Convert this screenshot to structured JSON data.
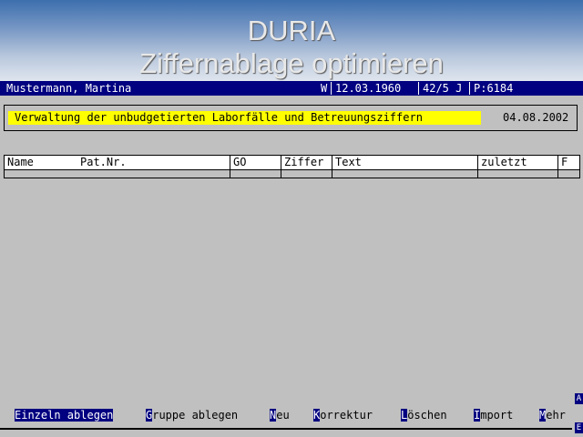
{
  "app": {
    "title": "DURIA",
    "subtitle": "Ziffernablage optimieren"
  },
  "patient": {
    "name": "Mustermann, Martina",
    "sex": "W",
    "birthdate": "12.03.1960",
    "age": "42/5 J",
    "pat_id": "P:6184"
  },
  "info": {
    "title": "Verwaltung der unbudgetierten Laborfälle und Betreuungsziffern",
    "date": "04.08.2002"
  },
  "table": {
    "columns": [
      "Name",
      "Pat.Nr.",
      "GO",
      "Ziffer",
      "Text",
      "zuletzt",
      "F"
    ]
  },
  "menu": {
    "einzeln": {
      "hk": "Einzeln ablegen",
      "rest": ""
    },
    "gruppe": {
      "hk": "G",
      "rest": "ruppe ablegen"
    },
    "neu": {
      "hk": "N",
      "rest": "eu"
    },
    "korrektur": {
      "hk": "K",
      "rest": "orrektur"
    },
    "loeschen": {
      "hk": "L",
      "rest": "öschen"
    },
    "import": {
      "hk": "I",
      "rest": "mport"
    },
    "mehr": {
      "hk": "M",
      "rest": "ehr"
    }
  },
  "scroll": {
    "up": "A",
    "down": "E"
  },
  "colors": {
    "menu_highlight": "#000080",
    "info_highlight": "#ffff00",
    "background": "#c0c0c0"
  }
}
